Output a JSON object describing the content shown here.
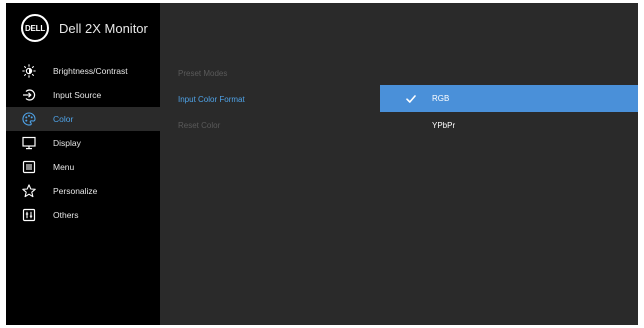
{
  "brand": {
    "logo_text": "DELL",
    "title": "Dell 2X Monitor"
  },
  "menu": {
    "items": [
      {
        "label": "Brightness/Contrast",
        "icon": "brightness-icon"
      },
      {
        "label": "Input Source",
        "icon": "input-source-icon"
      },
      {
        "label": "Color",
        "icon": "color-palette-icon",
        "active": true
      },
      {
        "label": "Display",
        "icon": "display-icon"
      },
      {
        "label": "Menu",
        "icon": "menu-icon"
      },
      {
        "label": "Personalize",
        "icon": "star-icon"
      },
      {
        "label": "Others",
        "icon": "others-icon"
      }
    ]
  },
  "submenu": {
    "items": [
      {
        "label": "Preset Modes"
      },
      {
        "label": "Input Color Format",
        "active": true
      },
      {
        "label": "Reset Color"
      }
    ]
  },
  "options": {
    "items": [
      {
        "label": "RGB",
        "selected": true
      },
      {
        "label": "YPbPr"
      }
    ]
  },
  "colors": {
    "accent": "#4fa3e8",
    "selection": "#4a90d9",
    "sidebar_bg": "#000000",
    "panel_bg": "#2a2a2a"
  }
}
